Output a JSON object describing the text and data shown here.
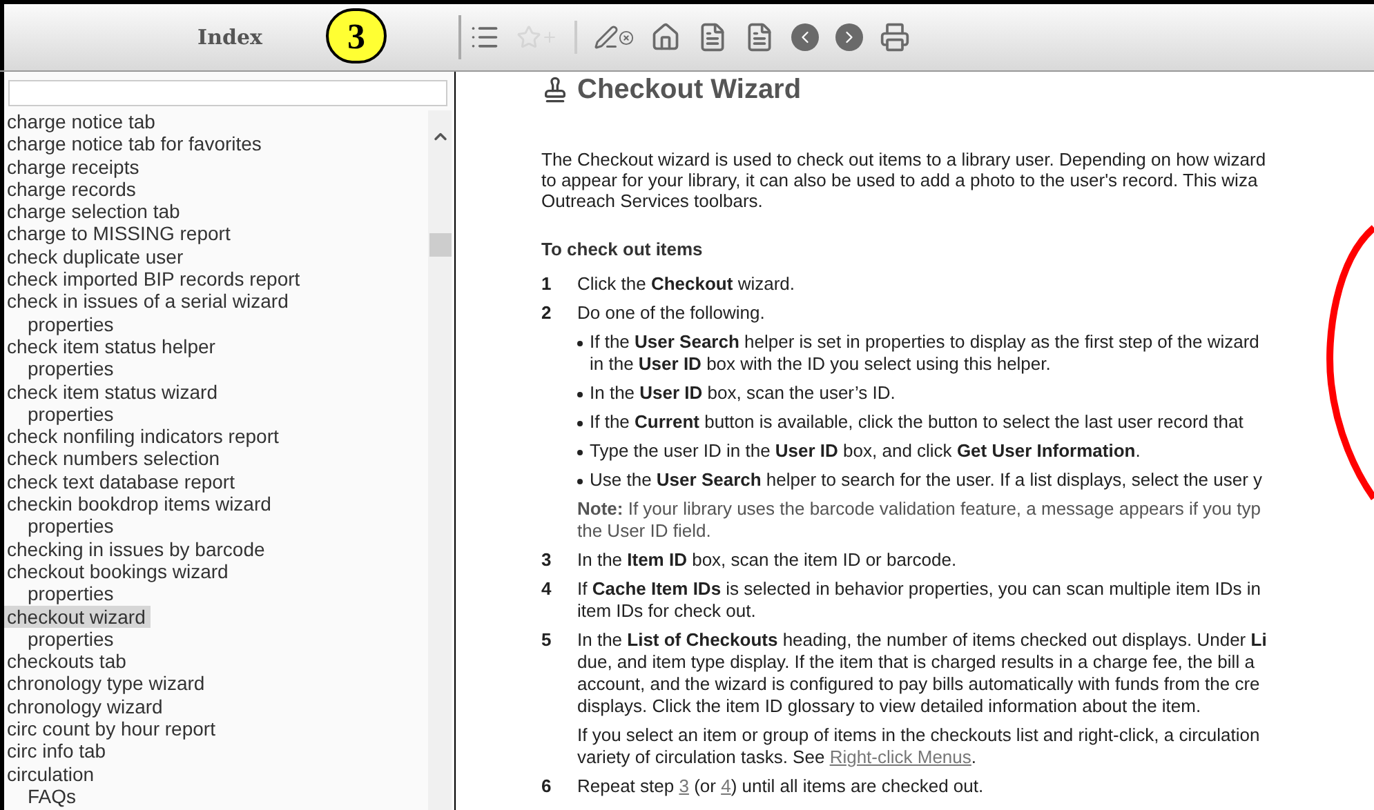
{
  "index_panel": {
    "title": "Index",
    "callout": "3",
    "items": [
      {
        "label": "charge notice tab",
        "selected": false
      },
      {
        "label": "charge notice tab for favorites",
        "selected": false
      },
      {
        "label": "charge receipts",
        "selected": false
      },
      {
        "label": "charge records",
        "selected": false
      },
      {
        "label": "charge selection tab",
        "selected": false
      },
      {
        "label": "charge to MISSING report",
        "selected": false
      },
      {
        "label": "check duplicate user",
        "selected": false
      },
      {
        "label": "check imported BIP records report",
        "selected": false
      },
      {
        "label": "check in issues of a serial wizard",
        "selected": false,
        "children": [
          {
            "label": "properties",
            "selected": false
          }
        ]
      },
      {
        "label": "check item status helper",
        "selected": false,
        "children": [
          {
            "label": "properties",
            "selected": false
          }
        ]
      },
      {
        "label": "check item status wizard",
        "selected": false,
        "children": [
          {
            "label": "properties",
            "selected": false
          }
        ]
      },
      {
        "label": "check nonfiling indicators report",
        "selected": false
      },
      {
        "label": "check numbers selection",
        "selected": false
      },
      {
        "label": "check text database report",
        "selected": false
      },
      {
        "label": "checkin bookdrop items wizard",
        "selected": false,
        "children": [
          {
            "label": "properties",
            "selected": false
          }
        ]
      },
      {
        "label": "checking in issues by barcode",
        "selected": false
      },
      {
        "label": "checkout bookings wizard",
        "selected": false,
        "children": [
          {
            "label": "properties",
            "selected": false
          }
        ]
      },
      {
        "label": "checkout wizard",
        "selected": true,
        "children": [
          {
            "label": "properties",
            "selected": false
          }
        ]
      },
      {
        "label": "checkouts tab",
        "selected": false
      },
      {
        "label": "chronology type wizard",
        "selected": false
      },
      {
        "label": "chronology wizard",
        "selected": false
      },
      {
        "label": "circ count by hour report",
        "selected": false
      },
      {
        "label": "circ info tab",
        "selected": false
      },
      {
        "label": "circulation",
        "selected": false,
        "children": [
          {
            "label": "FAQs",
            "selected": false
          }
        ]
      }
    ]
  },
  "toolbar": [
    {
      "kind": "list",
      "disabled": false
    },
    {
      "kind": "favorite",
      "disabled": true
    },
    {
      "kind": "separator"
    },
    {
      "kind": "clear",
      "disabled": false
    },
    {
      "kind": "home",
      "disabled": false
    },
    {
      "kind": "prev-topic",
      "disabled": false
    },
    {
      "kind": "next-topic",
      "disabled": false
    },
    {
      "kind": "back",
      "disabled": false
    },
    {
      "kind": "forward",
      "disabled": false
    },
    {
      "kind": "print",
      "disabled": false
    }
  ],
  "topic": {
    "title": "Checkout Wizard",
    "blocks": [
      {
        "kind": "para",
        "lines": [
          "The Checkout wizard is used to check out items to a library user. Depending on how wizard",
          "to appear for your library, it can also be used to add a photo to the user's record. This wiza",
          "Outreach Services toolbars."
        ]
      },
      {
        "kind": "heading",
        "lines": [
          "To check out items"
        ]
      },
      {
        "kind": "step",
        "number": "1",
        "lines": [
          "Click the **Checkout** wizard."
        ]
      },
      {
        "kind": "step",
        "number": "2",
        "lines": [
          "Do one of the following."
        ]
      },
      {
        "kind": "bullet",
        "lines": [
          "If the **User Search** helper is set in properties to display as the first step of the wizard",
          "in the **User ID** box with the ID you select using this helper."
        ]
      },
      {
        "kind": "bullet",
        "lines": [
          "In the **User ID** box, scan the user’s ID."
        ]
      },
      {
        "kind": "bullet",
        "lines": [
          "If the **Current** button is available, click the button to select the last user record that"
        ]
      },
      {
        "kind": "bullet",
        "lines": [
          "Type the user ID in the **User ID** box, and click **Get User Information**."
        ]
      },
      {
        "kind": "bullet",
        "lines": [
          "Use the **User Search** helper to search for the user. If a list displays, select the user y"
        ]
      },
      {
        "kind": "note",
        "lines": [
          "**Note:** If your library uses the barcode validation feature, a message appears if you typ",
          "the User ID field."
        ]
      },
      {
        "kind": "step",
        "number": "3",
        "lines": [
          "In the **Item ID** box, scan the item ID or barcode."
        ]
      },
      {
        "kind": "step",
        "number": "4",
        "lines": [
          "If **Cache Item IDs** is selected in behavior properties, you can scan multiple item IDs in",
          "item IDs for check out."
        ]
      },
      {
        "kind": "step",
        "number": "5",
        "lines": [
          "In the **List of Checkouts** heading, the number of items checked out displays. Under **Li**",
          "due, and item type display. If the item that is charged results in a charge fee, the bill a",
          "account, and the wizard is configured to pay bills automatically with funds from the cre",
          "displays. Click the item ID glossary to view detailed information about the item."
        ]
      },
      {
        "kind": "subpara",
        "lines": [
          "If you select an item or group of items in the checkouts list and right-click, a circulation",
          [
            {
              "kind": "text",
              "text": "variety of circulation tasks. See "
            },
            {
              "kind": "link",
              "text": "Right-click Menus"
            },
            {
              "kind": "text",
              "text": "."
            }
          ]
        ]
      },
      {
        "kind": "step",
        "number": "6",
        "lines": [
          [
            {
              "kind": "text",
              "text": "Repeat step "
            },
            {
              "kind": "link",
              "text": "3"
            },
            {
              "kind": "text",
              "text": " ("
            },
            {
              "kind": "text",
              "text": "or "
            },
            {
              "kind": "link",
              "text": "4"
            },
            {
              "kind": "text",
              "text": ") until all items are checked out."
            }
          ]
        ]
      }
    ]
  }
}
